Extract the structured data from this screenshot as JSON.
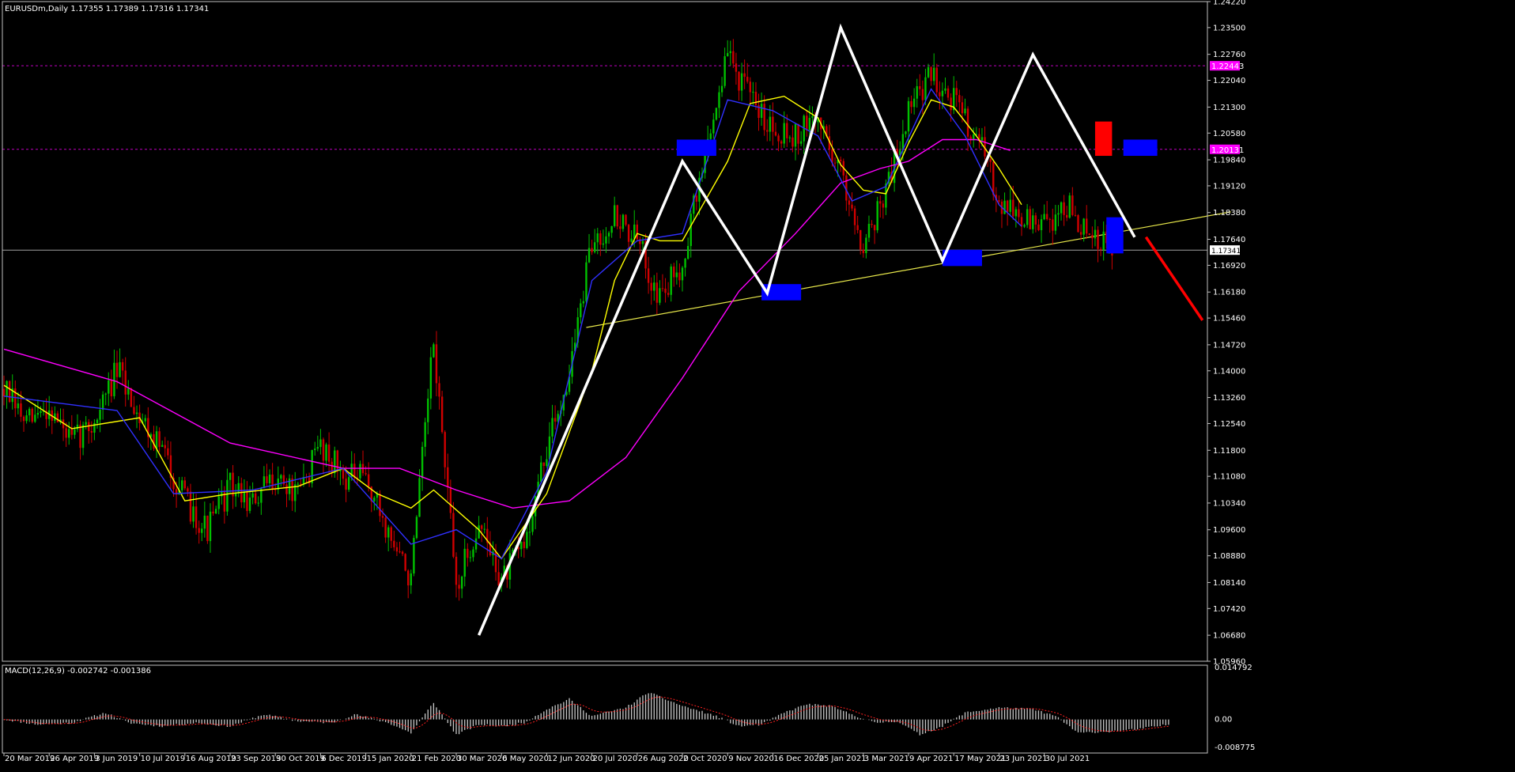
{
  "header": {
    "symbol_label": "EURUSDm,Daily  1.17355 1.17389 1.17316 1.17341",
    "macd_label": "MACD(12,26,9) -0.002742 -0.001386"
  },
  "colors": {
    "background": "#000000",
    "frame": "#c0c0c0",
    "text": "#ffffff",
    "bull_candle": "#00c000",
    "bear_candle": "#d00000",
    "ma_yellow": "#ffff00",
    "ma_magenta": "#ff00ff",
    "ma_blue": "#3030ff",
    "zigzag": "#ffffff",
    "trendline": "#e6e64a",
    "hline": "#c000c0",
    "projection": "#ff0000",
    "box_blue": "#0000ff",
    "box_red": "#ff0000",
    "macd_hist": "#c8c8c8",
    "macd_signal": "#ff2020"
  },
  "chart_data": {
    "type": "candlestick",
    "symbol": "EURUSDm",
    "timeframe": "Daily",
    "ohlc_current": {
      "open": 1.17355,
      "high": 1.17389,
      "low": 1.17316,
      "close": 1.17341
    },
    "ylim": [
      1.0596,
      1.2422
    ],
    "y_ticks": [
      "1.24220",
      "1.23500",
      "1.22760",
      "1.22040",
      "1.21300",
      "1.20580",
      "1.19840",
      "1.19120",
      "1.18380",
      "1.17640",
      "1.16920",
      "1.16180",
      "1.15460",
      "1.14720",
      "1.14000",
      "1.13260",
      "1.12540",
      "1.11800",
      "1.11080",
      "1.10340",
      "1.09600",
      "1.08880",
      "1.08140",
      "1.07420",
      "1.06680",
      "1.05960"
    ],
    "x_ticks": [
      "20 Mar 2019",
      "26 Apr 2019",
      "3 Jun 2019",
      "10 Jul 2019",
      "16 Aug 2019",
      "23 Sep 2019",
      "30 Oct 2019",
      "6 Dec 2019",
      "15 Jan 2020",
      "21 Feb 2020",
      "30 Mar 2020",
      "6 May 2020",
      "12 Jun 2020",
      "20 Jul 2020",
      "26 Aug 2020",
      "2 Oct 2020",
      "9 Nov 2020",
      "16 Dec 2020",
      "25 Jan 2021",
      "3 Mar 2021",
      "9 Apr 2021",
      "17 May 2021",
      "23 Jun 2021",
      "30 Jul 2021"
    ],
    "current_price_label": "1.17341",
    "current_price": 1.17341,
    "hlines": [
      {
        "label": "1.22443",
        "value": 1.22443
      },
      {
        "label": "1.20131",
        "value": 1.20131
      }
    ],
    "price_path": [
      [
        0,
        1.135
      ],
      [
        4,
        1.125
      ],
      [
        8,
        1.13
      ],
      [
        12,
        1.12
      ],
      [
        16,
        1.126
      ],
      [
        20,
        1.14
      ],
      [
        24,
        1.128
      ],
      [
        28,
        1.118
      ],
      [
        32,
        1.104
      ],
      [
        36,
        1.096
      ],
      [
        40,
        1.108
      ],
      [
        44,
        1.103
      ],
      [
        48,
        1.111
      ],
      [
        52,
        1.105
      ],
      [
        56,
        1.12
      ],
      [
        60,
        1.111
      ],
      [
        64,
        1.11
      ],
      [
        68,
        1.095
      ],
      [
        72,
        1.082
      ],
      [
        76,
        1.148
      ],
      [
        80,
        1.08
      ],
      [
        84,
        1.098
      ],
      [
        88,
        1.082
      ],
      [
        92,
        1.092
      ],
      [
        96,
        1.118
      ],
      [
        100,
        1.14
      ],
      [
        104,
        1.175
      ],
      [
        108,
        1.183
      ],
      [
        112,
        1.176
      ],
      [
        116,
        1.16
      ],
      [
        120,
        1.17
      ],
      [
        124,
        1.2
      ],
      [
        128,
        1.228
      ],
      [
        132,
        1.215
      ],
      [
        136,
        1.208
      ],
      [
        140,
        1.205
      ],
      [
        144,
        1.21
      ],
      [
        148,
        1.195
      ],
      [
        152,
        1.175
      ],
      [
        156,
        1.19
      ],
      [
        160,
        1.212
      ],
      [
        164,
        1.222
      ],
      [
        168,
        1.215
      ],
      [
        172,
        1.205
      ],
      [
        176,
        1.188
      ],
      [
        180,
        1.182
      ],
      [
        184,
        1.18
      ],
      [
        188,
        1.186
      ],
      [
        192,
        1.176
      ],
      [
        196,
        1.174
      ]
    ],
    "moving_averages": [
      {
        "color_key": "ma_magenta",
        "points": [
          [
            0,
            1.146
          ],
          [
            20,
            1.137
          ],
          [
            40,
            1.12
          ],
          [
            60,
            1.113
          ],
          [
            70,
            1.113
          ],
          [
            80,
            1.107
          ],
          [
            90,
            1.102
          ],
          [
            100,
            1.104
          ],
          [
            110,
            1.116
          ],
          [
            120,
            1.138
          ],
          [
            130,
            1.162
          ],
          [
            140,
            1.178
          ],
          [
            148,
            1.192
          ],
          [
            155,
            1.196
          ],
          [
            160,
            1.198
          ],
          [
            166,
            1.204
          ],
          [
            172,
            1.204
          ],
          [
            178,
            1.201
          ]
        ]
      },
      {
        "color_key": "ma_yellow",
        "points": [
          [
            0,
            1.136
          ],
          [
            12,
            1.124
          ],
          [
            24,
            1.127
          ],
          [
            32,
            1.104
          ],
          [
            40,
            1.106
          ],
          [
            52,
            1.108
          ],
          [
            60,
            1.113
          ],
          [
            66,
            1.106
          ],
          [
            72,
            1.102
          ],
          [
            76,
            1.107
          ],
          [
            84,
            1.096
          ],
          [
            88,
            1.088
          ],
          [
            96,
            1.106
          ],
          [
            104,
            1.14
          ],
          [
            108,
            1.165
          ],
          [
            112,
            1.178
          ],
          [
            116,
            1.176
          ],
          [
            120,
            1.176
          ],
          [
            128,
            1.198
          ],
          [
            132,
            1.214
          ],
          [
            138,
            1.216
          ],
          [
            144,
            1.21
          ],
          [
            148,
            1.197
          ],
          [
            152,
            1.19
          ],
          [
            156,
            1.189
          ],
          [
            160,
            1.203
          ],
          [
            164,
            1.215
          ],
          [
            168,
            1.213
          ],
          [
            172,
            1.205
          ],
          [
            176,
            1.196
          ],
          [
            180,
            1.186
          ]
        ]
      },
      {
        "color_key": "ma_blue",
        "points": [
          [
            0,
            1.133
          ],
          [
            20,
            1.129
          ],
          [
            30,
            1.106
          ],
          [
            44,
            1.107
          ],
          [
            60,
            1.113
          ],
          [
            72,
            1.092
          ],
          [
            80,
            1.096
          ],
          [
            88,
            1.088
          ],
          [
            96,
            1.112
          ],
          [
            104,
            1.165
          ],
          [
            112,
            1.176
          ],
          [
            120,
            1.178
          ],
          [
            128,
            1.215
          ],
          [
            136,
            1.212
          ],
          [
            144,
            1.205
          ],
          [
            150,
            1.187
          ],
          [
            156,
            1.191
          ],
          [
            164,
            1.218
          ],
          [
            170,
            1.205
          ],
          [
            176,
            1.186
          ],
          [
            180,
            1.18
          ]
        ]
      }
    ],
    "zigzag": [
      [
        84,
        1.0668
      ],
      [
        120,
        1.198
      ],
      [
        135,
        1.1615
      ],
      [
        148,
        1.235
      ],
      [
        166,
        1.1705
      ],
      [
        182,
        1.2275
      ],
      [
        200,
        1.177
      ]
    ],
    "projection": [
      [
        202,
        1.177
      ],
      [
        212,
        1.154
      ]
    ],
    "trendline": [
      [
        103,
        1.152
      ],
      [
        217,
        1.184
      ]
    ],
    "zones": [
      {
        "color_key": "box_blue",
        "t0": 119,
        "t1": 126,
        "y0": 1.1995,
        "y1": 1.204
      },
      {
        "color_key": "box_blue",
        "t0": 134,
        "t1": 141,
        "y0": 1.1595,
        "y1": 1.164
      },
      {
        "color_key": "box_blue",
        "t0": 166,
        "t1": 173,
        "y0": 1.169,
        "y1": 1.1735
      },
      {
        "color_key": "box_blue",
        "t0": 195,
        "t1": 198,
        "y0": 1.1725,
        "y1": 1.1825
      },
      {
        "color_key": "box_blue",
        "t0": 198,
        "t1": 204,
        "y0": 1.1995,
        "y1": 1.204
      },
      {
        "color_key": "box_red",
        "t0": 193,
        "t1": 196,
        "y0": 1.1995,
        "y1": 1.209
      }
    ],
    "macd": {
      "y_ticks": [
        "0.014792",
        "0.00",
        "-0.008775"
      ],
      "ylim": [
        -0.0099,
        0.016
      ],
      "hist_path": [
        [
          0,
          0.0
        ],
        [
          6,
          -0.0015
        ],
        [
          12,
          -0.001
        ],
        [
          18,
          0.002
        ],
        [
          22,
          -0.001
        ],
        [
          28,
          -0.002
        ],
        [
          34,
          -0.001
        ],
        [
          40,
          -0.002
        ],
        [
          46,
          0.0015
        ],
        [
          52,
          -0.0005
        ],
        [
          58,
          -0.001
        ],
        [
          62,
          0.0015
        ],
        [
          68,
          -0.001
        ],
        [
          72,
          -0.004
        ],
        [
          76,
          0.005
        ],
        [
          80,
          -0.0045
        ],
        [
          84,
          -0.0015
        ],
        [
          88,
          -0.002
        ],
        [
          92,
          -0.001
        ],
        [
          96,
          0.003
        ],
        [
          100,
          0.006
        ],
        [
          104,
          0.001
        ],
        [
          110,
          0.0035
        ],
        [
          114,
          0.008
        ],
        [
          120,
          0.004
        ],
        [
          126,
          0.001
        ],
        [
          130,
          -0.002
        ],
        [
          134,
          -0.0015
        ],
        [
          138,
          0.002
        ],
        [
          142,
          0.0045
        ],
        [
          146,
          0.004
        ],
        [
          150,
          0.0015
        ],
        [
          154,
          -0.001
        ],
        [
          158,
          -0.0005
        ],
        [
          162,
          -0.0045
        ],
        [
          166,
          -0.002
        ],
        [
          170,
          0.002
        ],
        [
          176,
          0.0035
        ],
        [
          182,
          0.003
        ],
        [
          186,
          0.001
        ],
        [
          190,
          -0.004
        ],
        [
          196,
          -0.0035
        ],
        [
          200,
          -0.003
        ],
        [
          204,
          -0.002
        ],
        [
          206,
          -0.0015
        ]
      ]
    }
  }
}
